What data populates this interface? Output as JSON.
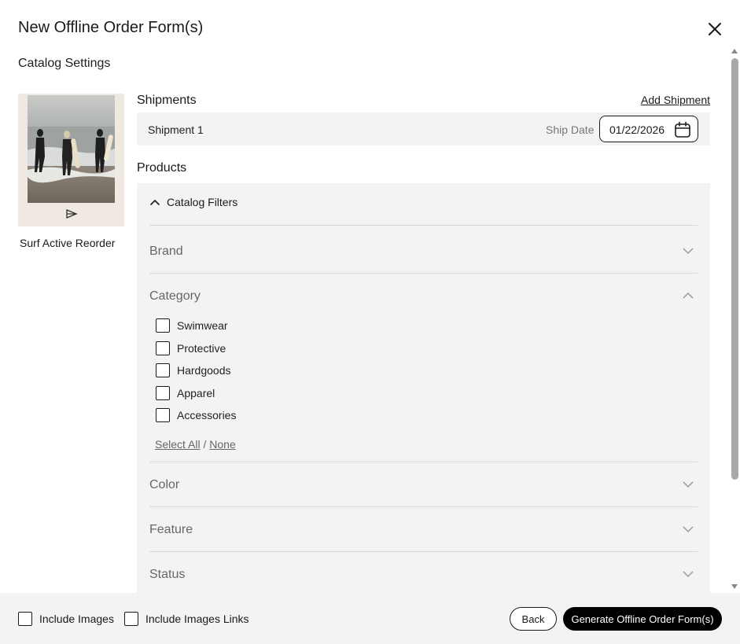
{
  "dialog": {
    "title": "New Offline Order Form(s)",
    "subtitle": "Catalog Settings"
  },
  "catalog": {
    "name": "Surf Active Reorder",
    "image_icon": "surfers-photo",
    "logo_icon": "brand-logo-icon"
  },
  "shipments": {
    "heading": "Shipments",
    "add_label": "Add Shipment",
    "items": [
      {
        "name": "Shipment 1",
        "date_label": "Ship Date",
        "date_value": "01/22/2026"
      }
    ]
  },
  "products": {
    "heading": "Products",
    "filters_label": "Catalog Filters",
    "facets": [
      {
        "label": "Brand",
        "expanded": false
      },
      {
        "label": "Category",
        "expanded": true
      },
      {
        "label": "Color",
        "expanded": false
      },
      {
        "label": "Feature",
        "expanded": false
      },
      {
        "label": "Status",
        "expanded": false
      }
    ],
    "category_options": [
      {
        "label": "Swimwear",
        "checked": false
      },
      {
        "label": "Protective",
        "checked": false
      },
      {
        "label": "Hardgoods",
        "checked": false
      },
      {
        "label": "Apparel",
        "checked": false
      },
      {
        "label": "Accessories",
        "checked": false
      }
    ],
    "select_all_label": "Select All",
    "separator": "/",
    "select_none_label": "None"
  },
  "footer": {
    "include_images_label": "Include Images",
    "include_images_checked": false,
    "include_links_label": "Include Images Links",
    "include_links_checked": false,
    "back_label": "Back",
    "generate_label": "Generate Offline Order Form(s)"
  },
  "colors": {
    "panel_bg": "#f3f3f4",
    "primary_button": "#000000",
    "text": "#1a1a1a",
    "muted_text": "#666666"
  }
}
